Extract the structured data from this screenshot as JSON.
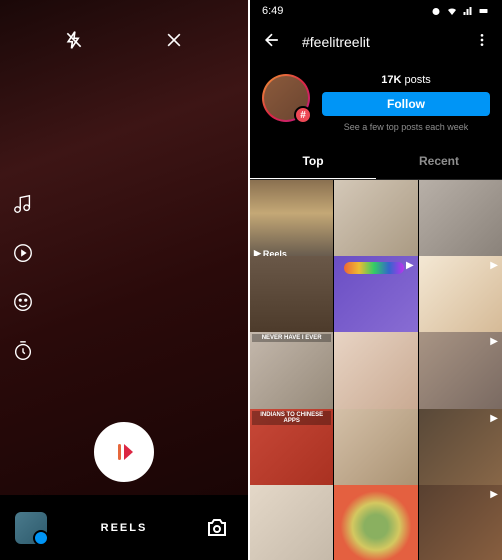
{
  "camera": {
    "mode_label": "REELS",
    "tools": {
      "flash": "flash-off",
      "close": "close",
      "audio": "audio",
      "speed": "speed",
      "effects": "effects",
      "timer": "timer"
    }
  },
  "browse": {
    "status_time": "6:49",
    "hashtag": "#feelitreelit",
    "post_count": "17K",
    "post_label": "posts",
    "follow_label": "Follow",
    "subtitle": "See a few top posts each week",
    "hashtag_badge": "#",
    "tabs": {
      "top": "Top",
      "recent": "Recent"
    },
    "reels_badge": "Reels",
    "cells": {
      "r3c1_text": "NEVER HAVE I EVER",
      "r4c1_text": "INDIANS TO CHINESE APPS"
    }
  }
}
